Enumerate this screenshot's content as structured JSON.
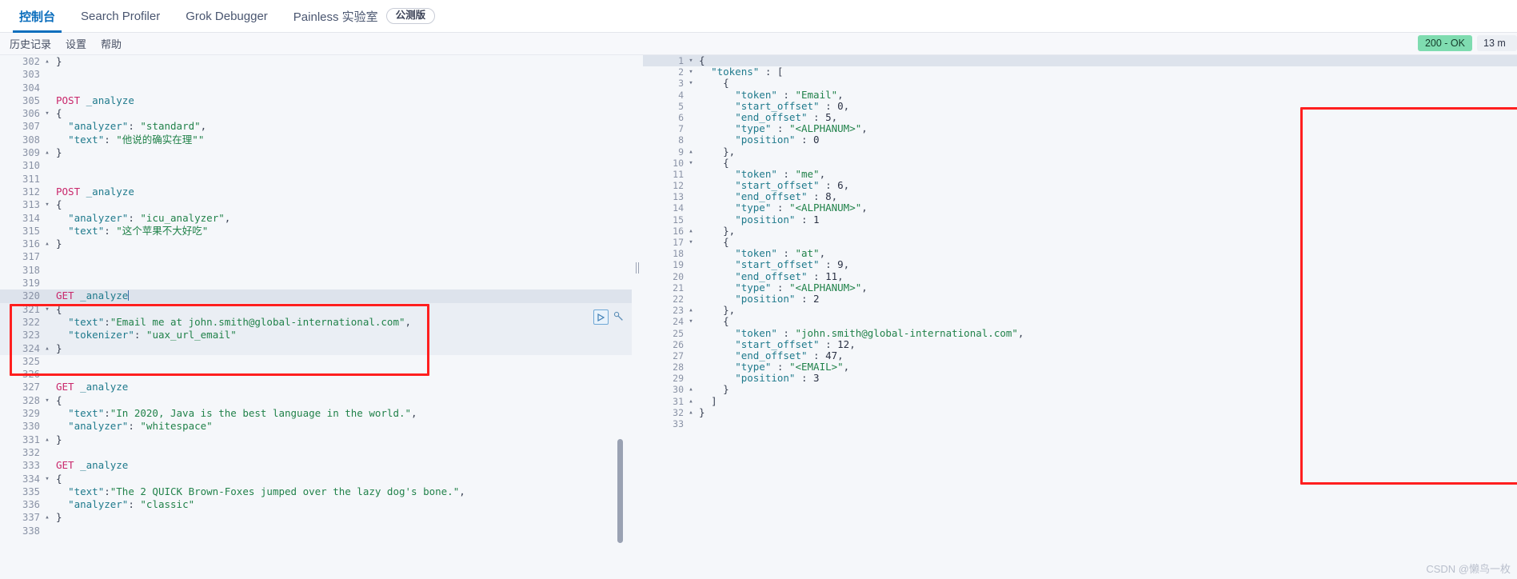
{
  "tabs": [
    {
      "label": "控制台",
      "active": true
    },
    {
      "label": "Search Profiler",
      "active": false
    },
    {
      "label": "Grok Debugger",
      "active": false
    },
    {
      "label": "Painless 实验室",
      "active": false,
      "badge": "公测版"
    }
  ],
  "subnav": [
    {
      "label": "历史记录"
    },
    {
      "label": "设置"
    },
    {
      "label": "帮助"
    }
  ],
  "status": {
    "code": "200 - OK",
    "time": "13 m"
  },
  "editor": {
    "lines": [
      {
        "num": "302",
        "fold": "▴",
        "text": "}"
      },
      {
        "num": "303",
        "fold": "",
        "text": ""
      },
      {
        "num": "304",
        "fold": "",
        "text": ""
      },
      {
        "num": "305",
        "fold": "",
        "text": "POST _analyze",
        "method": "POST",
        "url": " _analyze"
      },
      {
        "num": "306",
        "fold": "▾",
        "text": "{"
      },
      {
        "num": "307",
        "fold": "",
        "text": "  \"analyzer\": \"standard\","
      },
      {
        "num": "308",
        "fold": "",
        "text": "  \"text\": \"他说的确实在理\"\""
      },
      {
        "num": "309",
        "fold": "▴",
        "text": "}"
      },
      {
        "num": "310",
        "fold": "",
        "text": ""
      },
      {
        "num": "311",
        "fold": "",
        "text": ""
      },
      {
        "num": "312",
        "fold": "",
        "text": "POST _analyze",
        "method": "POST",
        "url": " _analyze"
      },
      {
        "num": "313",
        "fold": "▾",
        "text": "{"
      },
      {
        "num": "314",
        "fold": "",
        "text": "  \"analyzer\": \"icu_analyzer\","
      },
      {
        "num": "315",
        "fold": "",
        "text": "  \"text\": \"这个苹果不大好吃\""
      },
      {
        "num": "316",
        "fold": "▴",
        "text": "}"
      },
      {
        "num": "317",
        "fold": "",
        "text": ""
      },
      {
        "num": "318",
        "fold": "",
        "text": ""
      },
      {
        "num": "319",
        "fold": "",
        "text": ""
      },
      {
        "num": "320",
        "fold": "",
        "text": "GET _analyze",
        "method": "GET",
        "url": " _analyze",
        "caret": true,
        "highlight": true
      },
      {
        "num": "321",
        "fold": "▾",
        "text": "{",
        "soft": true
      },
      {
        "num": "322",
        "fold": "",
        "text": "  \"text\":\"Email me at john.smith@global-international.com\",",
        "soft": true
      },
      {
        "num": "323",
        "fold": "",
        "text": "  \"tokenizer\": \"uax_url_email\"",
        "soft": true
      },
      {
        "num": "324",
        "fold": "▴",
        "text": "}",
        "soft": true
      },
      {
        "num": "325",
        "fold": "",
        "text": ""
      },
      {
        "num": "326",
        "fold": "",
        "text": ""
      },
      {
        "num": "327",
        "fold": "",
        "text": "GET _analyze",
        "method": "GET",
        "url": " _analyze"
      },
      {
        "num": "328",
        "fold": "▾",
        "text": "{"
      },
      {
        "num": "329",
        "fold": "",
        "text": "  \"text\":\"In 2020, Java is the best language in the world.\","
      },
      {
        "num": "330",
        "fold": "",
        "text": "  \"analyzer\": \"whitespace\""
      },
      {
        "num": "331",
        "fold": "▴",
        "text": "}"
      },
      {
        "num": "332",
        "fold": "",
        "text": ""
      },
      {
        "num": "333",
        "fold": "",
        "text": "GET _analyze",
        "method": "GET",
        "url": " _analyze"
      },
      {
        "num": "334",
        "fold": "▾",
        "text": "{"
      },
      {
        "num": "335",
        "fold": "",
        "text": "  \"text\":\"The 2 QUICK Brown-Foxes jumped over the lazy dog's bone.\","
      },
      {
        "num": "336",
        "fold": "",
        "text": "  \"analyzer\": \"classic\""
      },
      {
        "num": "337",
        "fold": "▴",
        "text": "}"
      },
      {
        "num": "338",
        "fold": "",
        "text": ""
      }
    ]
  },
  "response": {
    "lines": [
      {
        "num": "1",
        "fold": "▾",
        "text": "{"
      },
      {
        "num": "2",
        "fold": "▾",
        "text": "  \"tokens\" : ["
      },
      {
        "num": "3",
        "fold": "▾",
        "text": "    {"
      },
      {
        "num": "4",
        "fold": "",
        "text": "      \"token\" : \"Email\","
      },
      {
        "num": "5",
        "fold": "",
        "text": "      \"start_offset\" : 0,"
      },
      {
        "num": "6",
        "fold": "",
        "text": "      \"end_offset\" : 5,"
      },
      {
        "num": "7",
        "fold": "",
        "text": "      \"type\" : \"<ALPHANUM>\","
      },
      {
        "num": "8",
        "fold": "",
        "text": "      \"position\" : 0"
      },
      {
        "num": "9",
        "fold": "▴",
        "text": "    },"
      },
      {
        "num": "10",
        "fold": "▾",
        "text": "    {"
      },
      {
        "num": "11",
        "fold": "",
        "text": "      \"token\" : \"me\","
      },
      {
        "num": "12",
        "fold": "",
        "text": "      \"start_offset\" : 6,"
      },
      {
        "num": "13",
        "fold": "",
        "text": "      \"end_offset\" : 8,"
      },
      {
        "num": "14",
        "fold": "",
        "text": "      \"type\" : \"<ALPHANUM>\","
      },
      {
        "num": "15",
        "fold": "",
        "text": "      \"position\" : 1"
      },
      {
        "num": "16",
        "fold": "▴",
        "text": "    },"
      },
      {
        "num": "17",
        "fold": "▾",
        "text": "    {"
      },
      {
        "num": "18",
        "fold": "",
        "text": "      \"token\" : \"at\","
      },
      {
        "num": "19",
        "fold": "",
        "text": "      \"start_offset\" : 9,"
      },
      {
        "num": "20",
        "fold": "",
        "text": "      \"end_offset\" : 11,"
      },
      {
        "num": "21",
        "fold": "",
        "text": "      \"type\" : \"<ALPHANUM>\","
      },
      {
        "num": "22",
        "fold": "",
        "text": "      \"position\" : 2"
      },
      {
        "num": "23",
        "fold": "▴",
        "text": "    },"
      },
      {
        "num": "24",
        "fold": "▾",
        "text": "    {"
      },
      {
        "num": "25",
        "fold": "",
        "text": "      \"token\" : \"john.smith@global-international.com\","
      },
      {
        "num": "26",
        "fold": "",
        "text": "      \"start_offset\" : 12,"
      },
      {
        "num": "27",
        "fold": "",
        "text": "      \"end_offset\" : 47,"
      },
      {
        "num": "28",
        "fold": "",
        "text": "      \"type\" : \"<EMAIL>\","
      },
      {
        "num": "29",
        "fold": "",
        "text": "      \"position\" : 3"
      },
      {
        "num": "30",
        "fold": "▴",
        "text": "    }"
      },
      {
        "num": "31",
        "fold": "▴",
        "text": "  ]"
      },
      {
        "num": "32",
        "fold": "▴",
        "text": "}"
      },
      {
        "num": "33",
        "fold": "",
        "text": ""
      }
    ]
  },
  "icons": {
    "run": "play-icon",
    "wrench": "wrench-icon"
  },
  "watermark": "CSDN @懒鸟一枚",
  "colors": {
    "accent": "#0b6ebd",
    "ok_badge": "#7fdcb0",
    "annotation": "#ff1f1f",
    "method": "#c9276b",
    "string": "#21824a",
    "key": "#1f7a8c"
  }
}
